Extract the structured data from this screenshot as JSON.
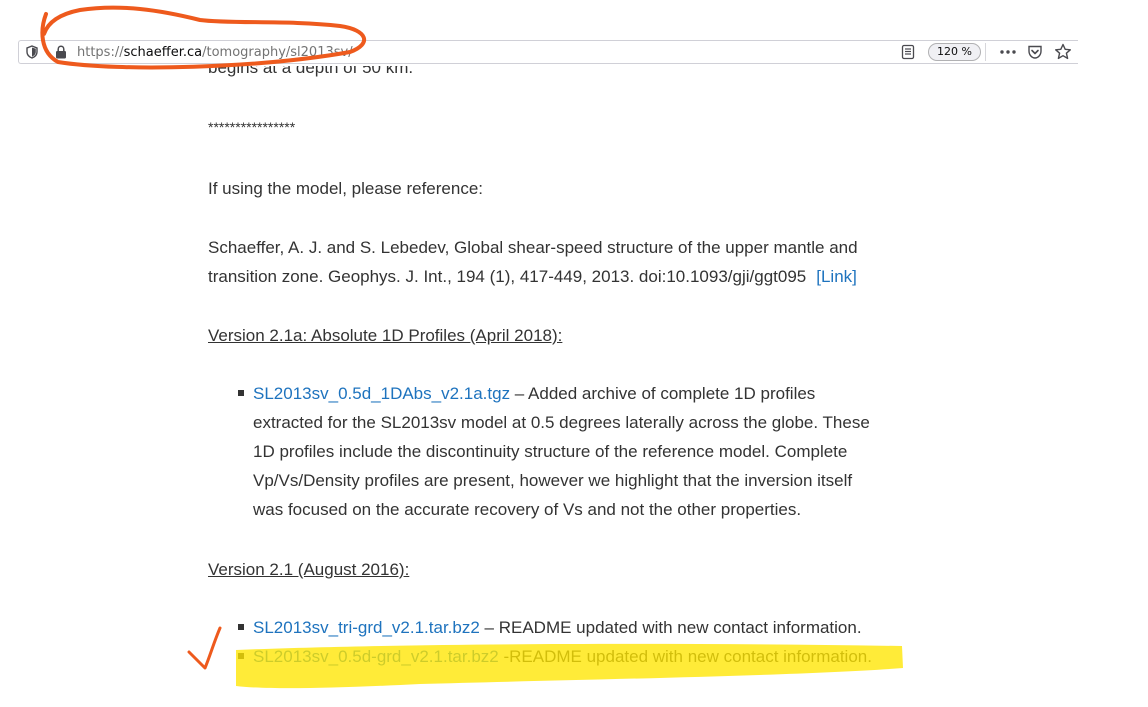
{
  "browser": {
    "url_prefix": "https://",
    "url_host": "schaeffer.ca",
    "url_path": "/tomography/sl2013sv/",
    "zoom": "120 %",
    "more_glyph": "•••"
  },
  "page": {
    "partial_line": "begins at a depth of 50 km.",
    "stars": "****************",
    "reference_intro": "If using the model, please reference:",
    "citation_line1": "Schaeffer, A. J. and S. Lebedev, Global shear-speed structure of the upper mantle and",
    "citation_line2": "transition zone. Geophys. J. Int., 194 (1), 417-449, 2013. doi:10.1093/gji/ggt095",
    "citation_link": "[Link]",
    "v21a_heading": "Version 2.1a: Absolute 1D Profiles (April 2018):",
    "v21a_items": [
      {
        "link": "SL2013sv_0.5d_1DAbs_v2.1a.tgz",
        "sep": " – ",
        "lines": [
          "Added archive of complete 1D profiles",
          "extracted for the SL2013sv model at 0.5 degrees laterally across the globe. These",
          "1D profiles include the discontinuity structure of the reference model. Complete",
          "Vp/Vs/Density profiles are present, however we highlight that the inversion itself",
          "was focused on the accurate recovery of Vs and not the other properties."
        ]
      }
    ],
    "v21_heading": "Version 2.1 (August 2016):",
    "v21_items": [
      {
        "link": "SL2013sv_tri-grd_v2.1.tar.bz2",
        "sep": " – ",
        "text": "README updated with new contact information."
      },
      {
        "link": "SL2013sv_0.5d-grd_v2.1.tar.bz2",
        "sep": " -",
        "text": "README updated with new contact information."
      }
    ]
  },
  "colors": {
    "link": "#1e73be",
    "annotation_orange": "#ee5a1d",
    "highlight_yellow": "#ffe600"
  }
}
